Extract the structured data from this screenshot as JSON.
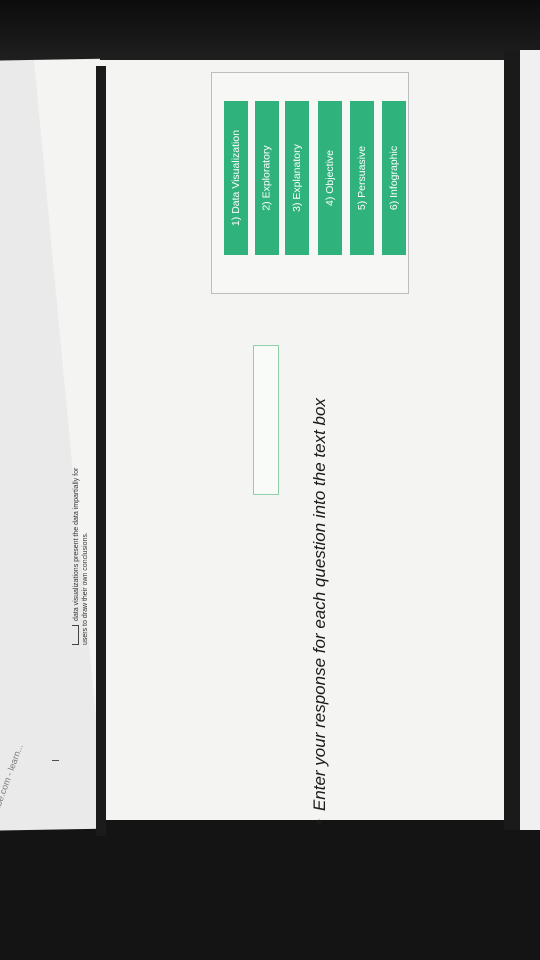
{
  "browser": {
    "url_fragment": "webapps.be.com - learn..."
  },
  "slide": {
    "prompt": "Enter your response for each question into the text box",
    "bullet": "•",
    "question": {
      "cursor": "I",
      "text_line1": "data visualizations present the data impartially for",
      "text_line2": "users to draw their own conclusions."
    },
    "answer_value": ""
  },
  "options": [
    {
      "label": "1) Data Visualization"
    },
    {
      "label": "2) Exploratory"
    },
    {
      "label": "3) Explanatory"
    },
    {
      "label": "4) Objective"
    },
    {
      "label": "5) Persuasive"
    },
    {
      "label": "6) Infographic"
    }
  ],
  "colors": {
    "option_bg": "#2fb27c",
    "answer_border": "#8fcfaa"
  }
}
